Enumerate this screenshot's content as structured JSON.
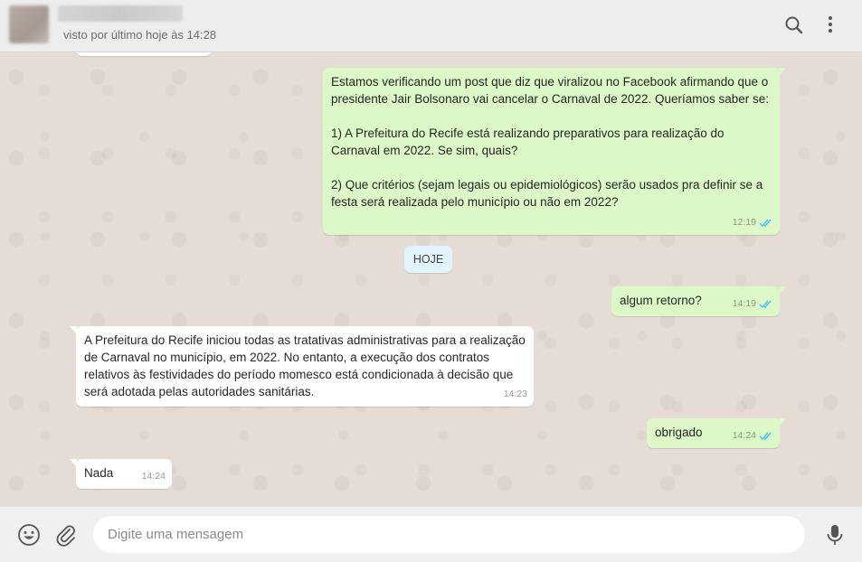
{
  "header": {
    "last_seen": "visto por último hoje às 14:28",
    "icons": [
      "search-icon",
      "menu-dots-icon"
    ]
  },
  "day_separator": "HOJE",
  "messages": [
    {
      "direction": "outgoing",
      "text": "Estamos verificando um post que diz que viralizou no Facebook afirmando que o presidente Jair Bolsonaro vai cancelar o Carnaval de 2022. Queríamos saber se:\n\n1) A Prefeitura do Recife está realizando preparativos para realização do Carnaval em 2022. Se sim, quais?\n\n2) Que critérios (sejam legais ou epidemiológicos) serão usados pra definir se a festa será realizada pelo município ou não em 2022?",
      "time": "12:19",
      "status": "read"
    },
    {
      "direction": "outgoing",
      "text": "algum retorno?",
      "time": "14:19",
      "status": "read"
    },
    {
      "direction": "incoming",
      "text": "A Prefeitura do Recife iniciou todas as tratativas administrativas para a realização de Carnaval no município, em 2022. No entanto, a execução dos contratos relativos  às festividades do período momesco está condicionada à decisão que será adotada pelas autoridades sanitárias.",
      "time": "14:23"
    },
    {
      "direction": "outgoing",
      "text": "obrigado",
      "time": "14:24",
      "status": "read"
    },
    {
      "direction": "incoming",
      "text": "Nada",
      "time": "14:24"
    }
  ],
  "composer": {
    "placeholder": "Digite uma mensagem",
    "value": "",
    "icons": [
      "emoji-icon",
      "attach-icon",
      "microphone-icon"
    ]
  },
  "colors": {
    "outgoing_bubble": "#dcf8c6",
    "incoming_bubble": "#ffffff",
    "read_ticks": "#4fc3f7",
    "chat_background": "#e5ddd5",
    "header_background": "#ededed"
  }
}
